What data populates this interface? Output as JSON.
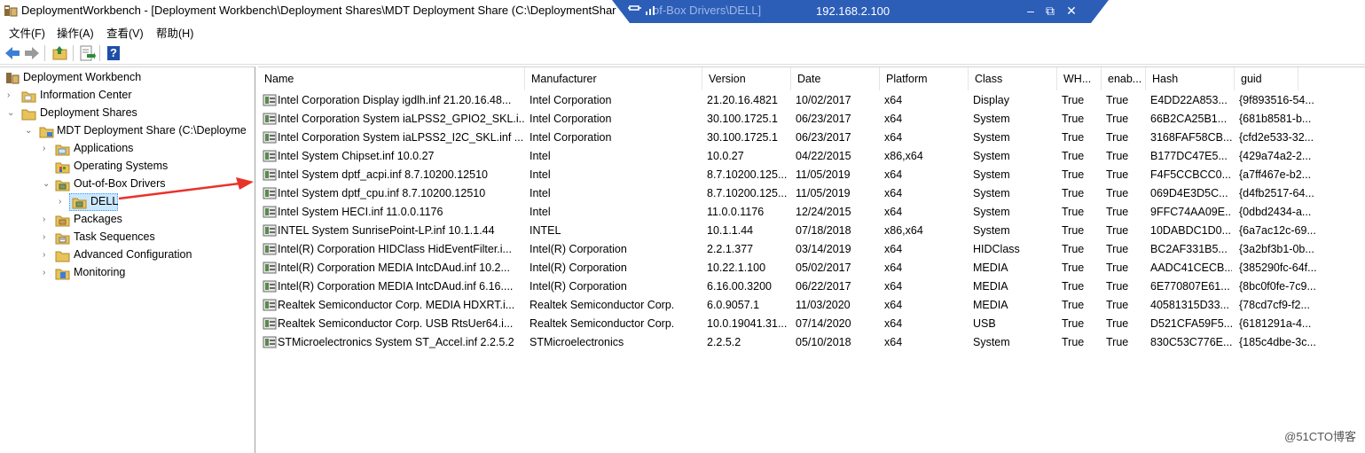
{
  "window": {
    "title": "DeploymentWorkbench - [Deployment Workbench\\Deployment Shares\\MDT Deployment Share (C:\\DeploymentShar",
    "title_tail": "of-Box Drivers\\DELL]"
  },
  "remote_bar": {
    "ip": "192.168.2.100",
    "minimize": "–",
    "restore": "⧉",
    "close": "✕"
  },
  "menu": [
    {
      "label": "文件(F)"
    },
    {
      "label": "操作(A)"
    },
    {
      "label": "查看(V)"
    },
    {
      "label": "帮助(H)"
    }
  ],
  "toolbar": {
    "icons": [
      "back-arrow-icon",
      "forward-arrow-icon",
      "up-folder-icon",
      "export-list-icon",
      "help-icon"
    ],
    "help_label": "?"
  },
  "tree": {
    "nodes": [
      {
        "label": "Deployment Workbench"
      },
      {
        "label": "Information Center"
      },
      {
        "label": "Deployment Shares"
      },
      {
        "label": "MDT Deployment Share (C:\\Deployme"
      },
      {
        "label": "Applications"
      },
      {
        "label": "Operating Systems"
      },
      {
        "label": "Out-of-Box Drivers"
      },
      {
        "label": "DELL"
      },
      {
        "label": "Packages"
      },
      {
        "label": "Task Sequences"
      },
      {
        "label": "Advanced Configuration"
      },
      {
        "label": "Monitoring"
      }
    ]
  },
  "list": {
    "columns": [
      "Name",
      "Manufacturer",
      "Version",
      "Date",
      "Platform",
      "Class",
      "WH...",
      "enab...",
      "Hash",
      "guid"
    ],
    "rows": [
      {
        "name": "Intel Corporation Display igdlh.inf 21.20.16.48...",
        "manufacturer": "Intel Corporation",
        "version": "21.20.16.4821",
        "date": "10/02/2017",
        "platform": "x64",
        "class": "Display",
        "whql": "True",
        "enabled": "True",
        "hash": "E4DD22A853...",
        "guid": "{9f893516-54..."
      },
      {
        "name": "Intel Corporation System iaLPSS2_GPIO2_SKL.i...",
        "manufacturer": "Intel Corporation",
        "version": "30.100.1725.1",
        "date": "06/23/2017",
        "platform": "x64",
        "class": "System",
        "whql": "True",
        "enabled": "True",
        "hash": "66B2CA25B1...",
        "guid": "{681b8581-b..."
      },
      {
        "name": "Intel Corporation System iaLPSS2_I2C_SKL.inf ...",
        "manufacturer": "Intel Corporation",
        "version": "30.100.1725.1",
        "date": "06/23/2017",
        "platform": "x64",
        "class": "System",
        "whql": "True",
        "enabled": "True",
        "hash": "3168FAF58CB...",
        "guid": "{cfd2e533-32..."
      },
      {
        "name": "Intel System Chipset.inf 10.0.27",
        "manufacturer": "Intel",
        "version": "10.0.27",
        "date": "04/22/2015",
        "platform": "x86,x64",
        "class": "System",
        "whql": "True",
        "enabled": "True",
        "hash": "B177DC47E5...",
        "guid": "{429a74a2-2..."
      },
      {
        "name": "Intel System dptf_acpi.inf 8.7.10200.12510",
        "manufacturer": "Intel",
        "version": "8.7.10200.125...",
        "date": "11/05/2019",
        "platform": "x64",
        "class": "System",
        "whql": "True",
        "enabled": "True",
        "hash": "F4F5CCBCC0...",
        "guid": "{a7ff467e-b2..."
      },
      {
        "name": "Intel System dptf_cpu.inf 8.7.10200.12510",
        "manufacturer": "Intel",
        "version": "8.7.10200.125...",
        "date": "11/05/2019",
        "platform": "x64",
        "class": "System",
        "whql": "True",
        "enabled": "True",
        "hash": "069D4E3D5C...",
        "guid": "{d4fb2517-64..."
      },
      {
        "name": "Intel System HECI.inf 11.0.0.1176",
        "manufacturer": "Intel",
        "version": "11.0.0.1176",
        "date": "12/24/2015",
        "platform": "x64",
        "class": "System",
        "whql": "True",
        "enabled": "True",
        "hash": "9FFC74AA09E...",
        "guid": "{0dbd2434-a..."
      },
      {
        "name": "INTEL System SunrisePoint-LP.inf 10.1.1.44",
        "manufacturer": "INTEL",
        "version": "10.1.1.44",
        "date": "07/18/2018",
        "platform": "x86,x64",
        "class": "System",
        "whql": "True",
        "enabled": "True",
        "hash": "10DABDC1D0...",
        "guid": "{6a7ac12c-69..."
      },
      {
        "name": "Intel(R) Corporation HIDClass HidEventFilter.i...",
        "manufacturer": "Intel(R) Corporation",
        "version": "2.2.1.377",
        "date": "03/14/2019",
        "platform": "x64",
        "class": "HIDClass",
        "whql": "True",
        "enabled": "True",
        "hash": "BC2AF331B5...",
        "guid": "{3a2bf3b1-0b..."
      },
      {
        "name": "Intel(R) Corporation MEDIA IntcDAud.inf 10.2...",
        "manufacturer": "Intel(R) Corporation",
        "version": "10.22.1.100",
        "date": "05/02/2017",
        "platform": "x64",
        "class": "MEDIA",
        "whql": "True",
        "enabled": "True",
        "hash": "AADC41CECB...",
        "guid": "{385290fc-64f..."
      },
      {
        "name": "Intel(R) Corporation MEDIA IntcDAud.inf 6.16....",
        "manufacturer": "Intel(R) Corporation",
        "version": "6.16.00.3200",
        "date": "06/22/2017",
        "platform": "x64",
        "class": "MEDIA",
        "whql": "True",
        "enabled": "True",
        "hash": "6E770807E61...",
        "guid": "{8bc0f0fe-7c9..."
      },
      {
        "name": "Realtek Semiconductor Corp. MEDIA HDXRT.i...",
        "manufacturer": "Realtek Semiconductor Corp.",
        "version": "6.0.9057.1",
        "date": "11/03/2020",
        "platform": "x64",
        "class": "MEDIA",
        "whql": "True",
        "enabled": "True",
        "hash": "40581315D33...",
        "guid": "{78cd7cf9-f2..."
      },
      {
        "name": "Realtek Semiconductor Corp. USB RtsUer64.i...",
        "manufacturer": "Realtek Semiconductor Corp.",
        "version": "10.0.19041.31...",
        "date": "07/14/2020",
        "platform": "x64",
        "class": "USB",
        "whql": "True",
        "enabled": "True",
        "hash": "D521CFA59F5...",
        "guid": "{6181291a-4..."
      },
      {
        "name": "STMicroelectronics System ST_Accel.inf 2.2.5.2",
        "manufacturer": "STMicroelectronics",
        "version": "2.2.5.2",
        "date": "05/10/2018",
        "platform": "x64",
        "class": "System",
        "whql": "True",
        "enabled": "True",
        "hash": "830C53C776E...",
        "guid": "{185c4dbe-3c..."
      }
    ]
  },
  "watermark": "@51CTO博客"
}
